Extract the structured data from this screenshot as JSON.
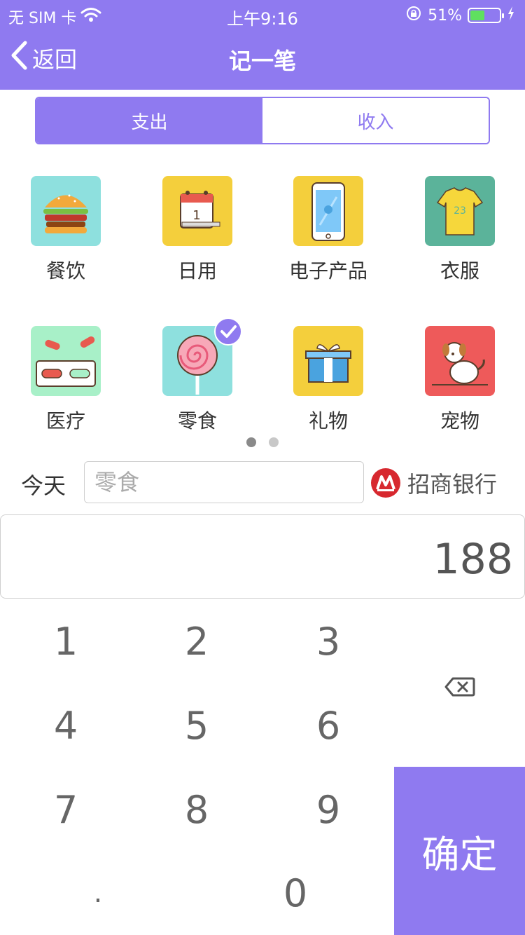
{
  "status_bar": {
    "carrier": "无 SIM 卡",
    "time": "上午9:16",
    "battery_percent": "51%",
    "battery_level": 0.51
  },
  "nav": {
    "back_label": "返回",
    "title": "记一笔"
  },
  "tabs": [
    {
      "label": "支出",
      "active": true
    },
    {
      "label": "收入",
      "active": false
    }
  ],
  "categories": [
    {
      "label": "餐饮",
      "icon": "burger-icon",
      "bg": "#8ee0de"
    },
    {
      "label": "日用",
      "icon": "calendar-icon",
      "bg": "#f4cf3c"
    },
    {
      "label": "电子产品",
      "icon": "phone-icon",
      "bg": "#f4cf3c"
    },
    {
      "label": "衣服",
      "icon": "tshirt-icon",
      "bg": "#5bb39a"
    },
    {
      "label": "医疗",
      "icon": "pills-icon",
      "bg": "#a8f0c8"
    },
    {
      "label": "零食",
      "icon": "lollipop-icon",
      "bg": "#8ee0de",
      "selected": true
    },
    {
      "label": "礼物",
      "icon": "gift-icon",
      "bg": "#f4cf3c"
    },
    {
      "label": "宠物",
      "icon": "dog-icon",
      "bg": "#ee5a5a"
    }
  ],
  "pager": {
    "pages": 2,
    "current": 1
  },
  "entry": {
    "date_label": "今天",
    "note_placeholder": "零食",
    "bank_name": "招商银行",
    "amount": "188"
  },
  "keypad": {
    "keys": [
      "1",
      "2",
      "3",
      "4",
      "5",
      "6",
      "7",
      "8",
      "9",
      ".",
      "0"
    ],
    "confirm_label": "确定"
  },
  "colors": {
    "accent": "#8f7af0"
  }
}
